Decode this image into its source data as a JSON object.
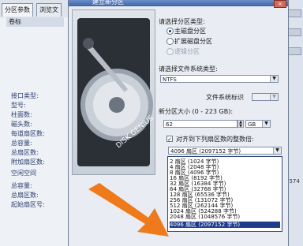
{
  "background": {
    "tabs": [
      "分区参数",
      "浏览文"
    ],
    "list_header": "卷标",
    "props_top": [
      "接口类型:",
      "型号:"
    ],
    "props_mid": [
      "柱面数:",
      "磁头数:",
      "每道扇区数:",
      "总容量:",
      "总扇区数:",
      "附加扇区数:"
    ],
    "props_bottom_title": "空闲空间",
    "props_bottom": [
      "总容量:",
      "总扇区数:",
      "起始扇区号:"
    ],
    "right_number": "0574"
  },
  "dialog": {
    "title": "建立新分区",
    "close_label": "×",
    "partition_type_label": "请选择分区类型:",
    "partition_types": [
      {
        "label": "主磁盘分区",
        "selected": true,
        "enabled": true
      },
      {
        "label": "扩展磁盘分区",
        "selected": false,
        "enabled": true
      },
      {
        "label": "逻辑分区",
        "selected": false,
        "enabled": false
      }
    ],
    "fs_label": "请选择文件系统类型:",
    "fs_value": "NTFS",
    "fs_id_label": "文件系统标识",
    "fs_id_value": "",
    "size_label": "新分区大小 (0 - 223 GB):",
    "size_value": "62",
    "size_unit": "GB",
    "align_checked": true,
    "align_label": "对齐到下列扇区数的整数倍:",
    "align_value": "4096 扇区 (2097152 字节)",
    "hdd_label": "DISK GENIUS",
    "align_options": [
      "2 扇区 (1024 字节)",
      "4 扇区 (2048 字节)",
      "8 扇区 (4096 字节)",
      "16 扇区 (8192 字节)",
      "32 扇区 (16384 字节)",
      "64 扇区 (32768 字节)",
      "128 扇区 (65536 字节)",
      "256 扇区 (131072 字节)",
      "512 扇区 (262144 字节)",
      "1024 扇区 (524288 字节)",
      "2048 扇区 (1048576 字节)",
      "4096 扇区 (2097152 字节)"
    ],
    "selected_option_index": 11
  },
  "colors": {
    "accent": "#1e3c8c",
    "arrow": "#f07a1a"
  }
}
